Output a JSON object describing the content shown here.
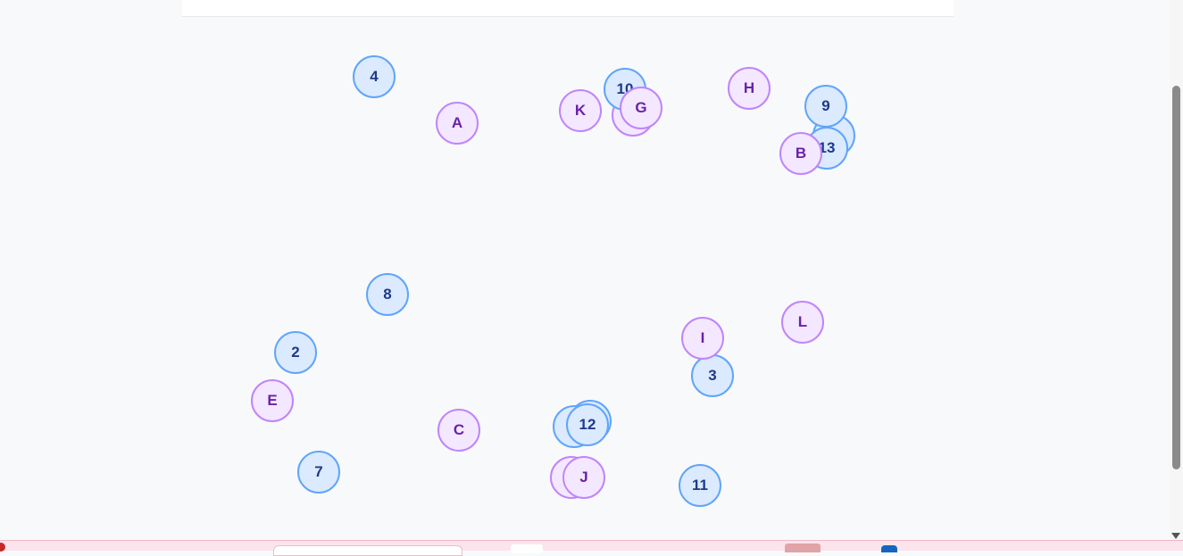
{
  "nodes": {
    "n4": "4",
    "n10": "10",
    "n9": "9",
    "n13": "13",
    "n8": "8",
    "n2": "2",
    "n3": "3",
    "n12": "12",
    "n7": "7",
    "n11": "11",
    "A": "A",
    "K": "K",
    "G": "G",
    "H": "H",
    "B": "B",
    "I": "I",
    "L": "L",
    "E": "E",
    "C": "C",
    "J": "J"
  },
  "colors": {
    "number_fill": "#dbeafe",
    "number_border": "#60a5fa",
    "number_text": "#1e3a8a",
    "letter_fill": "#f3e8ff",
    "letter_border": "#c084fc",
    "letter_text": "#6b21a8"
  }
}
